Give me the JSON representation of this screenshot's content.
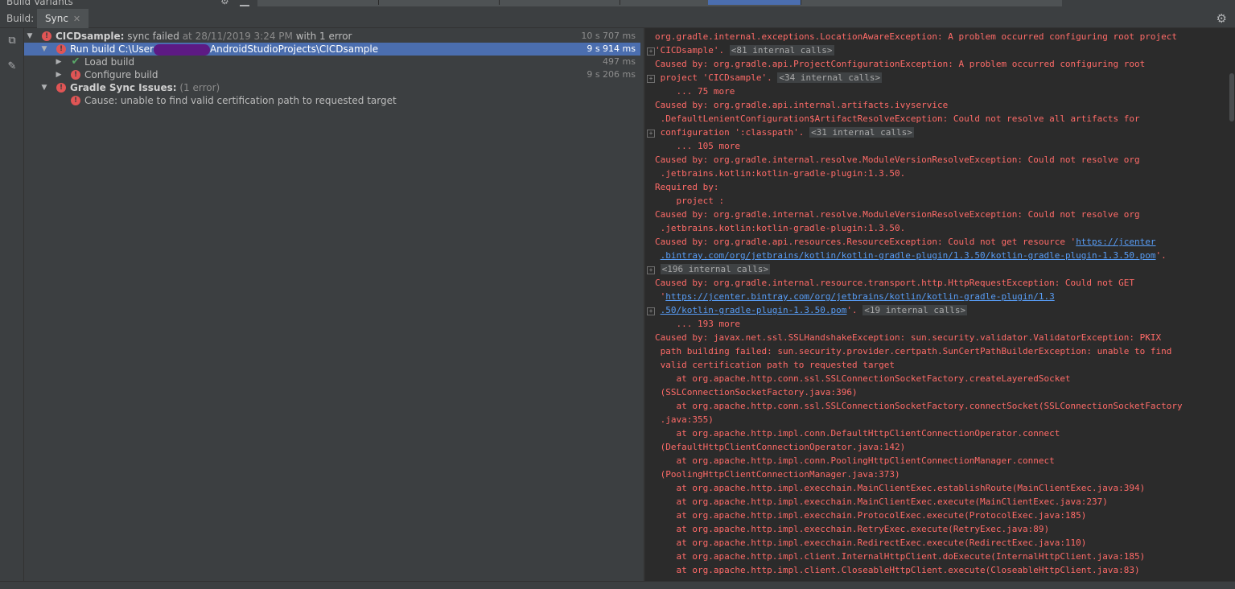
{
  "top": {
    "tool_window_title": "Build Variants"
  },
  "toolbar": {
    "build_label": "Build:",
    "tab_sync": "Sync",
    "close_glyph": "✕"
  },
  "tree": {
    "items": [
      {
        "bold": "CICDsample:",
        "label": " sync failed",
        "muted": " at 28/11/2019 3:24 PM",
        "extra": "  with 1 error",
        "time": "10 s 707 ms"
      },
      {
        "label_before": "Run build C:\\User",
        "label_after": "AndroidStudioProjects\\CICDsample",
        "time": "9 s 914 ms"
      },
      {
        "label": "Load build",
        "time": "497 ms"
      },
      {
        "label": "Configure build",
        "time": "9 s 206 ms"
      },
      {
        "bold": "Gradle Sync Issues:",
        "muted": " (1 error)"
      },
      {
        "label": "Cause: unable to find valid certification path to requested target"
      }
    ]
  },
  "console": {
    "lines": [
      {
        "t": "org.gradle.internal.exceptions.LocationAwareException: A problem occurred configuring root project "
      },
      {
        "t": "'CICDsample'. ",
        "fold": "<81 internal calls>"
      },
      {
        "t": "Caused by: org.gradle.api.ProjectConfigurationException: A problem occurred configuring root"
      },
      {
        "t": " project 'CICDsample'. ",
        "fold": "<34 internal calls>"
      },
      {
        "t": "    ... 75 more"
      },
      {
        "t": "Caused by: org.gradle.api.internal.artifacts.ivyservice"
      },
      {
        "t": " .DefaultLenientConfiguration$ArtifactResolveException: Could not resolve all artifacts for"
      },
      {
        "t": " configuration ':classpath'. ",
        "fold": "<31 internal calls>"
      },
      {
        "t": "    ... 105 more"
      },
      {
        "t": "Caused by: org.gradle.internal.resolve.ModuleVersionResolveException: Could not resolve org"
      },
      {
        "t": " .jetbrains.kotlin:kotlin-gradle-plugin:1.3.50."
      },
      {
        "t": "Required by:"
      },
      {
        "t": "    project :"
      },
      {
        "t": "Caused by: org.gradle.internal.resolve.ModuleVersionResolveException: Could not resolve org"
      },
      {
        "t": " .jetbrains.kotlin:kotlin-gradle-plugin:1.3.50."
      },
      {
        "t": "Caused by: org.gradle.api.resources.ResourceException: Could not get resource '",
        "link": "https://jcenter"
      },
      {
        "t": " ",
        "link": ".bintray.com/org/jetbrains/kotlin/kotlin-gradle-plugin/1.3.50/kotlin-gradle-plugin-1.3.50.pom",
        "after": "'."
      },
      {
        "t": " ",
        "fold": "<196 internal calls>"
      },
      {
        "t": "Caused by: org.gradle.internal.resource.transport.http.HttpRequestException: Could not GET"
      },
      {
        "t": " '",
        "link": "https://jcenter.bintray.com/org/jetbrains/kotlin/kotlin-gradle-plugin/1.3"
      },
      {
        "t": " ",
        "link": ".50/kotlin-gradle-plugin-1.3.50.pom",
        "after": "'. ",
        "fold": "<19 internal calls>"
      },
      {
        "t": "    ... 193 more"
      },
      {
        "t": "Caused by: javax.net.ssl.SSLHandshakeException: sun.security.validator.ValidatorException: PKIX"
      },
      {
        "t": " path building failed: sun.security.provider.certpath.SunCertPathBuilderException: unable to find"
      },
      {
        "t": " valid certification path to requested target"
      },
      {
        "t": "    at org.apache.http.conn.ssl.SSLConnectionSocketFactory.createLayeredSocket"
      },
      {
        "t": " (SSLConnectionSocketFactory.java:396)"
      },
      {
        "t": "    at org.apache.http.conn.ssl.SSLConnectionSocketFactory.connectSocket(SSLConnectionSocketFactory"
      },
      {
        "t": " .java:355)"
      },
      {
        "t": "    at org.apache.http.impl.conn.DefaultHttpClientConnectionOperator.connect"
      },
      {
        "t": " (DefaultHttpClientConnectionOperator.java:142)"
      },
      {
        "t": "    at org.apache.http.impl.conn.PoolingHttpClientConnectionManager.connect"
      },
      {
        "t": " (PoolingHttpClientConnectionManager.java:373)"
      },
      {
        "t": "    at org.apache.http.impl.execchain.MainClientExec.establishRoute(MainClientExec.java:394)"
      },
      {
        "t": "    at org.apache.http.impl.execchain.MainClientExec.execute(MainClientExec.java:237)"
      },
      {
        "t": "    at org.apache.http.impl.execchain.ProtocolExec.execute(ProtocolExec.java:185)"
      },
      {
        "t": "    at org.apache.http.impl.execchain.RetryExec.execute(RetryExec.java:89)"
      },
      {
        "t": "    at org.apache.http.impl.execchain.RedirectExec.execute(RedirectExec.java:110)"
      },
      {
        "t": "    at org.apache.http.impl.client.InternalHttpClient.doExecute(InternalHttpClient.java:185)"
      },
      {
        "t": "    at org.apache.http.impl.client.CloseableHttpClient.execute(CloseableHttpClient.java:83)"
      }
    ]
  },
  "colors": {
    "error": "#ff6b68",
    "link": "#589df6",
    "selection": "#4b6eaf",
    "success": "#59a869"
  },
  "icons": [
    "settings-gear-icon",
    "restore-layout-icon",
    "pin-icon",
    "error-icon",
    "check-icon",
    "expand-arrow-icon"
  ]
}
